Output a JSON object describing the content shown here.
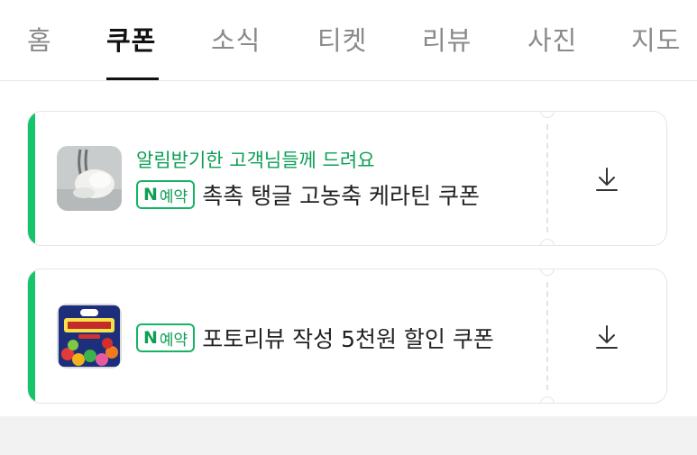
{
  "tabs": [
    {
      "label": "홈",
      "active": false
    },
    {
      "label": "쿠폰",
      "active": true
    },
    {
      "label": "소식",
      "active": false
    },
    {
      "label": "티켓",
      "active": false
    },
    {
      "label": "리뷰",
      "active": false
    },
    {
      "label": "사진",
      "active": false
    },
    {
      "label": "지도",
      "active": false
    }
  ],
  "coupons": [
    {
      "subtitle": "알림받기한 고객님들께 드려요",
      "badge_n": "N",
      "badge_text": "예약",
      "title": "촉촉 탱글 고농축 케라틴 쿠폰",
      "thumb_icon": "cream-product-thumbnail",
      "action_icon": "download-icon"
    },
    {
      "subtitle": "",
      "badge_n": "N",
      "badge_text": "예약",
      "title": "포토리뷰 작성 5천원 할인 쿠폰",
      "thumb_icon": "candy-box-thumbnail",
      "action_icon": "download-icon"
    }
  ],
  "colors": {
    "accent": "#15c46b",
    "badge_green": "#0d9f55"
  }
}
